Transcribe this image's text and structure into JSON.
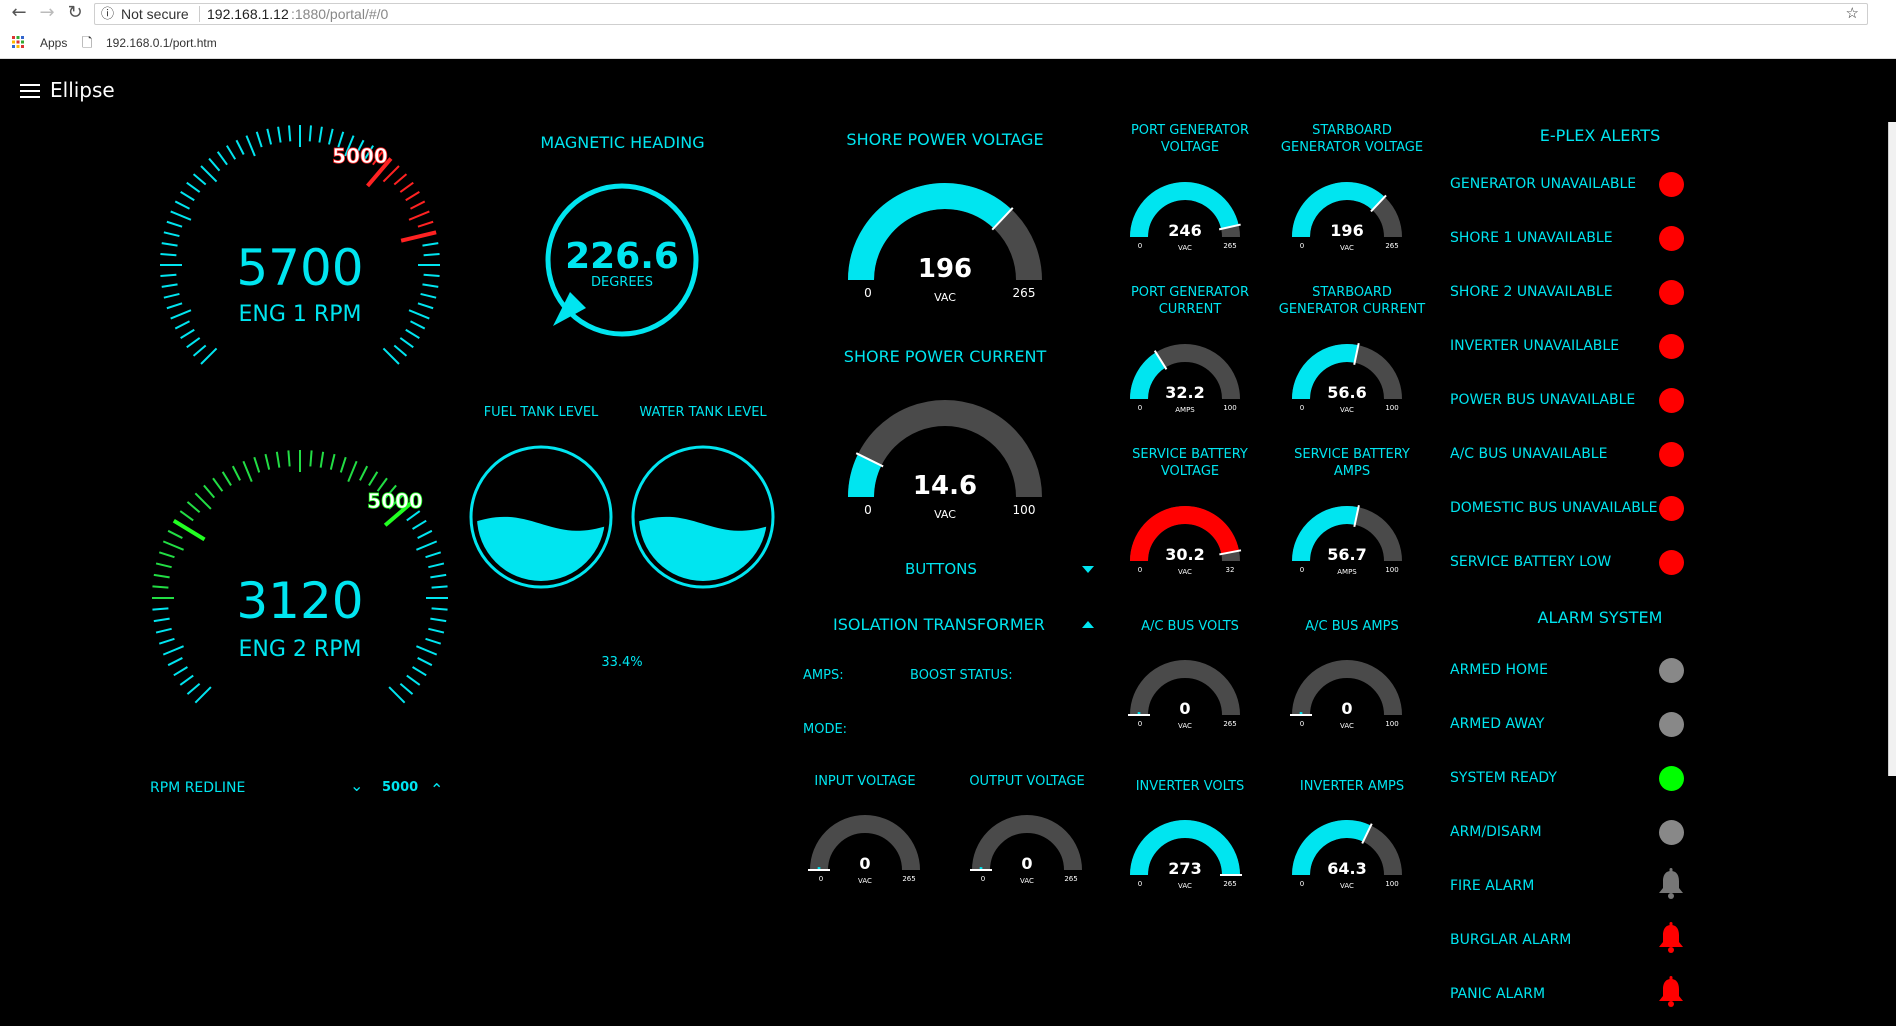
{
  "browser": {
    "security": "Not secure",
    "url_host": "192.168.1.12",
    "url_rest": ":1880/portal/#/0",
    "bookmark_apps": "Apps",
    "bookmark_page": "192.168.0.1/port.htm"
  },
  "app": {
    "title": "Ellipse"
  },
  "rpm": {
    "eng1": {
      "value": "5700",
      "label": "ENG 1 RPM",
      "redline_label": "5000"
    },
    "eng2": {
      "value": "3120",
      "label": "ENG 2 RPM",
      "redline_label": "5000"
    },
    "redline": {
      "label": "RPM REDLINE",
      "value": "5000"
    }
  },
  "heading": {
    "title": "MAGNETIC HEADING",
    "value": "226.6",
    "unit": "DEGREES"
  },
  "tanks": {
    "fuel": {
      "title": "FUEL TANK LEVEL",
      "level": 0.33
    },
    "water": {
      "title": "WATER TANK LEVEL",
      "level": 0.33
    },
    "percent_text": "33.4%"
  },
  "shore": {
    "voltage": {
      "title": "SHORE POWER VOLTAGE",
      "value": "196",
      "unit": "VAC",
      "min": "0",
      "max": "265",
      "fraction": 0.74
    },
    "current": {
      "title": "SHORE POWER CURRENT",
      "value": "14.6",
      "unit": "VAC",
      "min": "0",
      "max": "100",
      "fraction": 0.146
    }
  },
  "buttons": {
    "label": "BUTTONS"
  },
  "iso": {
    "title": "ISOLATION TRANSFORMER",
    "amps": "AMPS:",
    "boost": "BOOST STATUS:",
    "mode": "MODE:",
    "input": {
      "title": "INPUT VOLTAGE",
      "value": "0",
      "unit": "VAC",
      "min": "0",
      "max": "265",
      "fraction": 0
    },
    "output": {
      "title": "OUTPUT VOLTAGE",
      "value": "0",
      "unit": "VAC",
      "min": "0",
      "max": "265",
      "fraction": 0
    }
  },
  "small_gauges": {
    "port_gen_volt": {
      "title1": "PORT GENERATOR",
      "title2": "VOLTAGE",
      "value": "246",
      "unit": "VAC",
      "min": "0",
      "max": "265",
      "fraction": 0.93
    },
    "stbd_gen_volt": {
      "title1": "STARBOARD",
      "title2": "GENERATOR VOLTAGE",
      "value": "196",
      "unit": "VAC",
      "min": "0",
      "max": "265",
      "fraction": 0.74
    },
    "port_gen_cur": {
      "title1": "PORT GENERATOR",
      "title2": "CURRENT",
      "value": "32.2",
      "unit": "AMPS",
      "min": "0",
      "max": "100",
      "fraction": 0.322
    },
    "stbd_gen_cur": {
      "title1": "STARBOARD",
      "title2": "GENERATOR CURRENT",
      "value": "56.6",
      "unit": "VAC",
      "min": "0",
      "max": "100",
      "fraction": 0.566
    },
    "svc_batt_volt": {
      "title1": "SERVICE BATTERY",
      "title2": "VOLTAGE",
      "value": "30.2",
      "unit": "VAC",
      "min": "0",
      "max": "32",
      "fraction": 0.94
    },
    "svc_batt_amps": {
      "title1": "SERVICE BATTERY",
      "title2": "AMPS",
      "value": "56.7",
      "unit": "AMPS",
      "min": "0",
      "max": "100",
      "fraction": 0.567
    },
    "ac_bus_volts": {
      "title1": "A/C BUS VOLTS",
      "title2": "",
      "value": "0",
      "unit": "VAC",
      "min": "0",
      "max": "265",
      "fraction": 0
    },
    "ac_bus_amps": {
      "title1": "A/C BUS AMPS",
      "title2": "",
      "value": "0",
      "unit": "VAC",
      "min": "0",
      "max": "100",
      "fraction": 0
    },
    "inv_volts": {
      "title1": "INVERTER VOLTS",
      "title2": "",
      "value": "273",
      "unit": "VAC",
      "min": "0",
      "max": "265",
      "fraction": 1.0
    },
    "inv_amps": {
      "title1": "INVERTER AMPS",
      "title2": "",
      "value": "64.3",
      "unit": "VAC",
      "min": "0",
      "max": "100",
      "fraction": 0.643
    }
  },
  "alerts": {
    "title": "E-PLEX ALERTS",
    "items": [
      "GENERATOR UNAVAILABLE",
      "SHORE 1 UNAVAILABLE",
      "SHORE 2 UNAVAILABLE",
      "INVERTER UNAVAILABLE",
      "POWER BUS UNAVAILABLE",
      "A/C BUS UNAVAILABLE",
      "DOMESTIC BUS UNAVAILABLE",
      "SERVICE BATTERY LOW"
    ]
  },
  "alarm": {
    "title": "ALARM SYSTEM",
    "items": [
      "ARMED HOME",
      "ARMED AWAY",
      "SYSTEM READY",
      "ARM/DISARM",
      "FIRE ALARM",
      "BURGLAR ALARM",
      "PANIC ALARM"
    ]
  },
  "colors": {
    "accent": "#00e5f0",
    "track": "#4a4a4a",
    "red": "#ff0000",
    "green": "#00ff00",
    "gray": "#888888"
  }
}
